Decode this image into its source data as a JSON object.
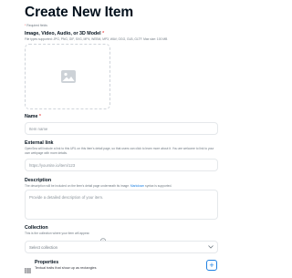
{
  "page": {
    "title": "Create New Item",
    "required_note": "Required fields"
  },
  "media": {
    "label": "Image, Video, Audio, or 3D Model",
    "help": "File types supported: JPG, PNG, GIF, SVG, MP4, WEBM, MP3, WAV, OGG, GLB, GLTF. Max size: 100 MB",
    "dropzone_icon": "image-icon"
  },
  "name": {
    "label": "Name",
    "placeholder": "Item name"
  },
  "external_link": {
    "label": "External link",
    "help": "OpenSea will include a link to this URL on this item's detail page, so that users can click to learn more about it. You are welcome to link to your own webpage with more details.",
    "placeholder": "https://yoursite.io/item/123"
  },
  "description": {
    "label": "Description",
    "help_prefix": "The description will be included on the item's detail page underneath its image. ",
    "help_link": "Markdown",
    "help_suffix": " syntax is supported.",
    "placeholder": "Provide a detailed description of your item."
  },
  "collection": {
    "label": "Collection",
    "help": "This is the collection where your item will appear.",
    "info_icon": "info-icon",
    "selected": "Select collection",
    "chevron_icon": "chevron-down-icon"
  },
  "properties": {
    "title": "Properties",
    "description": "Textual traits that show up as rectangles",
    "icon": "list-icon",
    "add_label": "+"
  },
  "colors": {
    "accent": "#2081e2",
    "required": "#eb5757",
    "text": "#04111d",
    "muted": "#707a83",
    "border": "#e5e8eb"
  }
}
